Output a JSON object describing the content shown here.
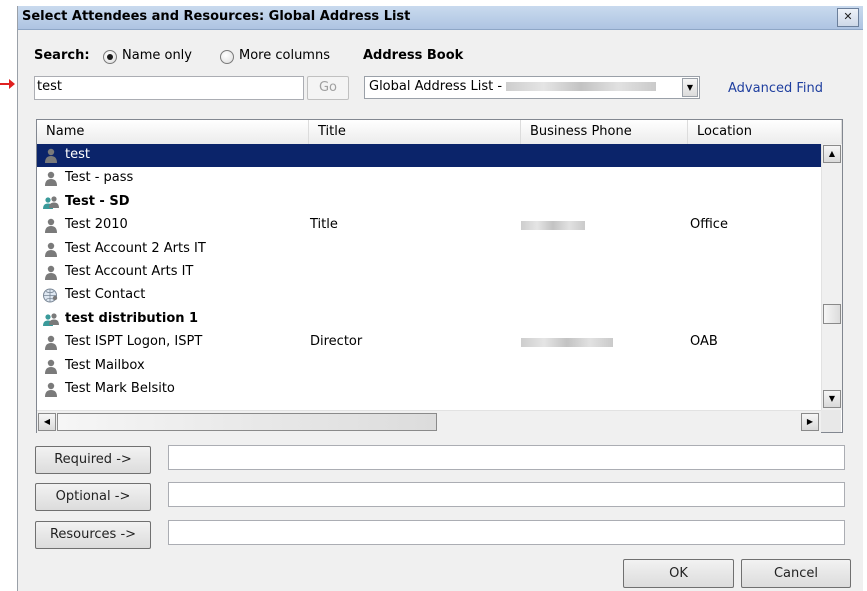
{
  "window": {
    "title": "Select Attendees and Resources: Global Address List",
    "close_glyph": "✕"
  },
  "search": {
    "label": "Search:",
    "option_name_only": "Name only",
    "option_more_columns": "More columns",
    "selected": "Name only",
    "value": "test",
    "go_label": "Go"
  },
  "address_book": {
    "label": "Address Book",
    "selected": "Global Address List -",
    "advanced_find": "Advanced Find"
  },
  "columns": [
    "Name",
    "Title",
    "Business Phone",
    "Location"
  ],
  "rows": [
    {
      "name": "test",
      "title": "",
      "phone_redacted": false,
      "location": "",
      "icon": "user-icon",
      "bold": false,
      "selected": true
    },
    {
      "name": "Test - pass",
      "title": "",
      "phone_redacted": false,
      "location": "",
      "icon": "user-icon",
      "bold": false,
      "selected": false
    },
    {
      "name": "Test - SD",
      "title": "",
      "phone_redacted": false,
      "location": "",
      "icon": "group-icon",
      "bold": true,
      "selected": false
    },
    {
      "name": "Test 2010",
      "title": "Title",
      "phone_redacted": true,
      "location": "Office",
      "icon": "user-icon",
      "bold": false,
      "selected": false
    },
    {
      "name": "Test Account 2 Arts IT",
      "title": "",
      "phone_redacted": false,
      "location": "",
      "icon": "user-icon",
      "bold": false,
      "selected": false
    },
    {
      "name": "Test Account Arts IT",
      "title": "",
      "phone_redacted": false,
      "location": "",
      "icon": "user-icon",
      "bold": false,
      "selected": false
    },
    {
      "name": "Test Contact",
      "title": "",
      "phone_redacted": false,
      "location": "",
      "icon": "contact-globe-icon",
      "bold": false,
      "selected": false
    },
    {
      "name": "test distribution 1",
      "title": "",
      "phone_redacted": false,
      "location": "",
      "icon": "group-icon",
      "bold": true,
      "selected": false
    },
    {
      "name": "Test ISPT Logon, ISPT",
      "title": "Director",
      "phone_redacted": true,
      "location": "OAB",
      "icon": "user-icon",
      "bold": false,
      "selected": false
    },
    {
      "name": "Test Mailbox",
      "title": "",
      "phone_redacted": false,
      "location": "",
      "icon": "user-icon",
      "bold": false,
      "selected": false
    },
    {
      "name": "Test Mark Belsito",
      "title": "",
      "phone_redacted": false,
      "location": "",
      "icon": "user-icon",
      "bold": false,
      "selected": false
    }
  ],
  "recipients": {
    "required_label": "Required ->",
    "optional_label": "Optional ->",
    "resources_label": "Resources ->",
    "required_value": "",
    "optional_value": "",
    "resources_value": ""
  },
  "footer": {
    "ok_label": "OK",
    "cancel_label": "Cancel"
  },
  "colors": {
    "selection": "#0b246a",
    "link": "#1f3f9f",
    "annotation_arrow": "#e02020",
    "group_icon": "#2a8f8f"
  }
}
